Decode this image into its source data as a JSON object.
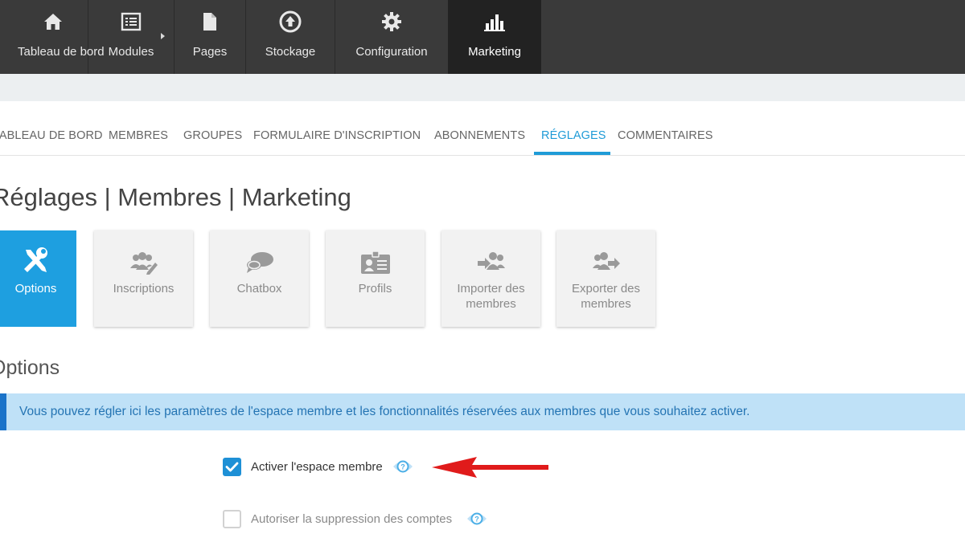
{
  "topnav": {
    "items": [
      {
        "label": "Tableau de bord",
        "icon": "home-icon"
      },
      {
        "label": "Modules",
        "icon": "modules-icon"
      },
      {
        "label": "Pages",
        "icon": "page-icon"
      },
      {
        "label": "Stockage",
        "icon": "storage-icon"
      },
      {
        "label": "Configuration",
        "icon": "gear-icon"
      },
      {
        "label": "Marketing",
        "icon": "bar-chart-icon",
        "active": true
      }
    ]
  },
  "subtabs": {
    "items": [
      {
        "label": "TABLEAU DE BORD"
      },
      {
        "label": "MEMBRES"
      },
      {
        "label": "GROUPES"
      },
      {
        "label": "FORMULAIRE D'INSCRIPTION"
      },
      {
        "label": "ABONNEMENTS"
      },
      {
        "label": "RÉGLAGES",
        "active": true
      },
      {
        "label": "COMMENTAIRES"
      }
    ]
  },
  "page_title": "Réglages | Membres | Marketing",
  "tiles": [
    {
      "label": "Options",
      "icon": "tools-icon",
      "active": true
    },
    {
      "label": "Inscriptions",
      "icon": "users-edit-icon"
    },
    {
      "label": "Chatbox",
      "icon": "chat-icon"
    },
    {
      "label": "Profils",
      "icon": "id-card-icon"
    },
    {
      "label": "Importer des membres",
      "icon": "import-users-icon"
    },
    {
      "label": "Exporter des membres",
      "icon": "export-users-icon"
    }
  ],
  "section_title": "Options",
  "info_message": "Vous pouvez régler ici les paramètres de l'espace membre et les fonctionnalités réservées aux membres que vous souhaitez activer.",
  "options": [
    {
      "label": "Activer l'espace membre",
      "checked": true
    },
    {
      "label": "Autoriser la suppression des comptes",
      "checked": false
    }
  ],
  "colors": {
    "accent": "#1e9fe0",
    "topnav_bg": "#3a3a3a",
    "info_bg": "#bfe1f7",
    "arrow": "#e01b1b"
  }
}
